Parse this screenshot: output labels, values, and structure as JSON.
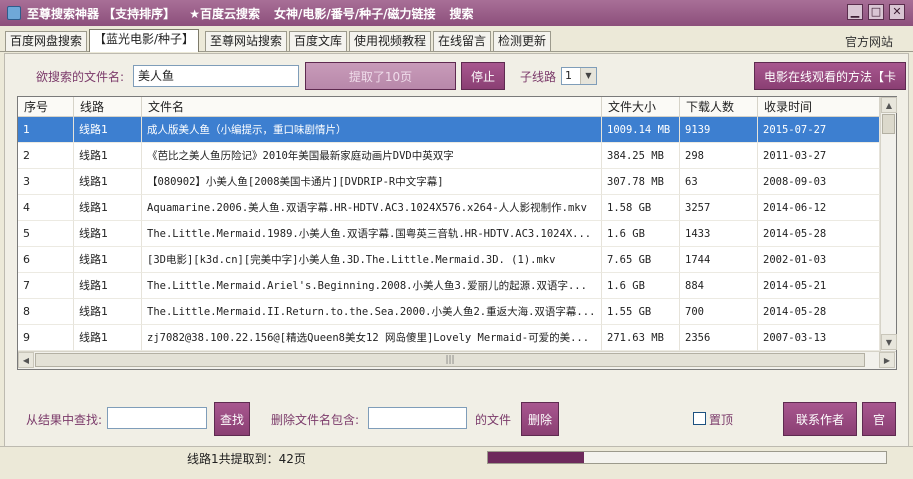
{
  "titlebar": {
    "segments": [
      "至尊搜索神器 【支持排序】",
      "★百度云搜索",
      "女神/电影/番号/种子/磁力链接",
      "搜索"
    ]
  },
  "window_controls": {
    "minimize": "▁",
    "maximize": "□",
    "close": "✕"
  },
  "tabs": [
    "百度网盘搜索",
    "【蓝光电影/种子】",
    "至尊网站搜索",
    "百度文库",
    "使用视频教程",
    "在线留言",
    "检测更新"
  ],
  "active_tab": 1,
  "official_link": "官方网站",
  "search": {
    "label": "欲搜索的文件名:",
    "value": "美人鱼",
    "fetch_button": "提取了10页",
    "stop_button": "停止",
    "subline_label": "子线路",
    "subline_value": "1",
    "online_button": "电影在线观看的方法【卡"
  },
  "table": {
    "columns": [
      "序号",
      "线路",
      "文件名",
      "文件大小",
      "下载人数",
      "收录时间"
    ],
    "rows": [
      {
        "id": "1",
        "line": "线路1",
        "name": "成人版美人鱼（小编提示，重口味剧情片）",
        "size": "1009.14 MB",
        "downloads": "9139",
        "date": "2015-07-27",
        "selected": true
      },
      {
        "id": "2",
        "line": "线路1",
        "name": "《芭比之美人鱼历险记》2010年美国最新家庭动画片DVD中英双字",
        "size": "384.25 MB",
        "downloads": "298",
        "date": "2011-03-27"
      },
      {
        "id": "3",
        "line": "线路1",
        "name": "【080902】小美人鱼[2008美国卡通片][DVDRIP-R中文字幕]",
        "size": "307.78 MB",
        "downloads": "63",
        "date": "2008-09-03"
      },
      {
        "id": "4",
        "line": "线路1",
        "name": "Aquamarine.2006.美人鱼.双语字幕.HR-HDTV.AC3.1024X576.x264-人人影视制作.mkv",
        "size": "1.58 GB",
        "downloads": "3257",
        "date": "2014-06-12"
      },
      {
        "id": "5",
        "line": "线路1",
        "name": "The.Little.Mermaid.1989.小美人鱼.双语字幕.国粤英三音轨.HR-HDTV.AC3.1024X...",
        "size": "1.6 GB",
        "downloads": "1433",
        "date": "2014-05-28"
      },
      {
        "id": "6",
        "line": "线路1",
        "name": "[3D电影][k3d.cn][完美中字]小美人鱼.3D.The.Little.Mermaid.3D.  (1).mkv",
        "size": "7.65 GB",
        "downloads": "1744",
        "date": "2002-01-03"
      },
      {
        "id": "7",
        "line": "线路1",
        "name": "The.Little.Mermaid.Ariel's.Beginning.2008.小美人鱼3.爱丽儿的起源.双语字...",
        "size": "1.6 GB",
        "downloads": "884",
        "date": "2014-05-21"
      },
      {
        "id": "8",
        "line": "线路1",
        "name": "The.Little.Mermaid.II.Return.to.the.Sea.2000.小美人鱼2.重返大海.双语字幕...",
        "size": "1.55 GB",
        "downloads": "700",
        "date": "2014-05-28"
      },
      {
        "id": "9",
        "line": "线路1",
        "name": "zj7082@38.100.22.156@[精选Queen8美女12   网岛傻里]Lovely Mermaid-可爱的美...",
        "size": "271.63 MB",
        "downloads": "2356",
        "date": "2007-03-13"
      }
    ]
  },
  "filter": {
    "find_label": "从结果中查找:",
    "find_value": "",
    "find_button": "查找",
    "delete_label": "删除文件名包含:",
    "delete_value": "",
    "files_label": "的文件",
    "delete_button": "删除",
    "pin_label": "置顶",
    "contact_button": "联系作者",
    "extra_button": "官"
  },
  "status": {
    "text": "线路1共提取到：42页",
    "progress_fraction": 0.24
  },
  "colors": {
    "title_bar": "#8c4f7b",
    "accent_button": "#8a3f73",
    "selected_row": "#3d7fd0",
    "progress": "#6d2a5c"
  }
}
